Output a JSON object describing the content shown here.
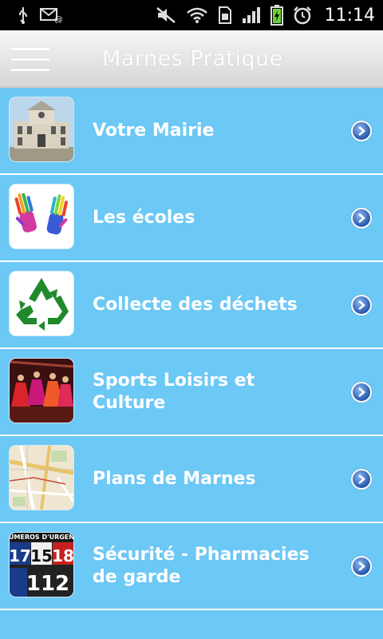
{
  "status_bar": {
    "time": "11:14",
    "icons": [
      "usb-icon",
      "email-icon",
      "mute-icon",
      "wifi-icon",
      "sim-icon",
      "signal-icon",
      "battery-icon",
      "alarm-icon"
    ]
  },
  "header": {
    "title": "Marnes Pratique",
    "menu_icon": "hamburger-menu-icon"
  },
  "menu": {
    "items": [
      {
        "label": "Votre Mairie",
        "icon": "mairie-photo"
      },
      {
        "label": "Les écoles",
        "icon": "hands-photo"
      },
      {
        "label": "Collecte des déchets",
        "icon": "recycle-icon"
      },
      {
        "label": "Sports Loisirs et Culture",
        "icon": "dance-photo"
      },
      {
        "label": "Plans de Marnes",
        "icon": "map-photo"
      },
      {
        "label": "Sécurité - Pharmacies de garde",
        "icon": "emergency-numbers-image"
      }
    ],
    "thumb_texts": {
      "emergency_header": "UMEROS D'URGEN",
      "n17": "17",
      "n15": "15",
      "n18": "18",
      "n112": "112"
    }
  },
  "colors": {
    "list_background": "#6cc8f5",
    "divider": "#ffffff",
    "chevron": "#2556b0"
  }
}
